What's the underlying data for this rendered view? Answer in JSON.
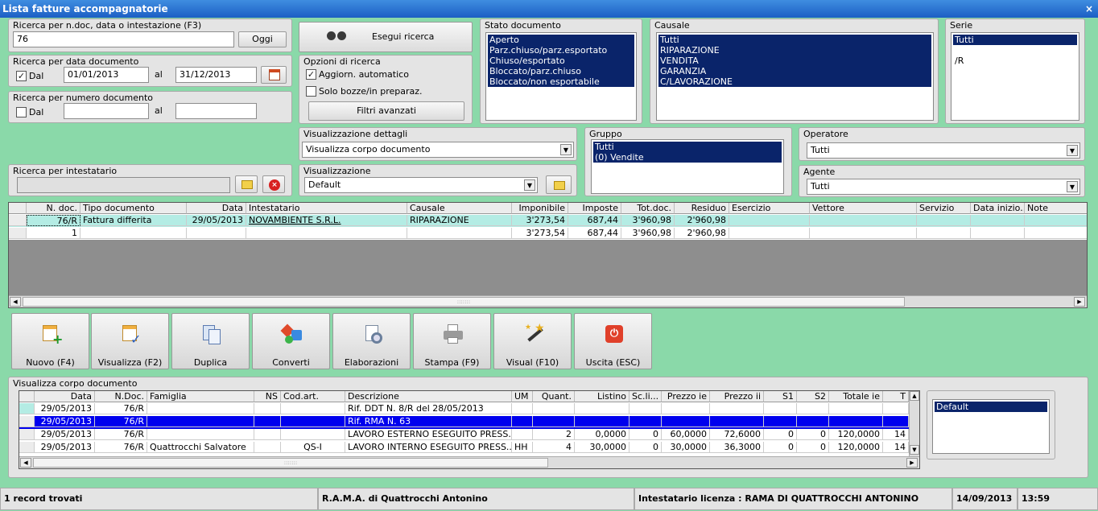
{
  "window": {
    "title": "Lista fatture accompagnatorie",
    "close": "×"
  },
  "search_ndoc": {
    "label": "Ricerca per n.doc, data o intestazione (F3)",
    "value": "76",
    "today_button": "Oggi"
  },
  "search_date": {
    "label": "Ricerca per data documento",
    "from_check": "✓",
    "from_label": "Dal",
    "from": "01/01/2013",
    "to_label": "al",
    "to": "31/12/2013"
  },
  "search_number": {
    "label": "Ricerca per numero documento",
    "from_label": "Dal",
    "to_label": "al"
  },
  "search_holder": {
    "label": "Ricerca per intestatario"
  },
  "execute_button": "Esegui ricerca",
  "options": {
    "label": "Opzioni di ricerca",
    "auto_update": "Aggiorn. automatico",
    "auto_check": "✓",
    "drafts_only": "Solo bozze/in preparaz.",
    "advanced_filters": "Filtri avanzati"
  },
  "stato": {
    "label": "Stato documento",
    "items": [
      "Aperto",
      "Parz.chiuso/parz.esportato",
      "Chiuso/esportato",
      "Bloccato/parz.chiuso",
      "Bloccato/non esportabile"
    ]
  },
  "causale": {
    "label": "Causale",
    "items": [
      "Tutti",
      "RIPARAZIONE",
      "VENDITA",
      "GARANZIA",
      "C/LAVORAZIONE"
    ]
  },
  "serie": {
    "label": "Serie",
    "items": [
      "Tutti",
      "",
      "/R"
    ]
  },
  "vis_dettagli": {
    "label": "Visualizzazione dettagli",
    "value": "Visualizza corpo documento"
  },
  "visualizzazione": {
    "label": "Visualizzazione",
    "value": "Default"
  },
  "gruppo": {
    "label": "Gruppo",
    "items": [
      "Tutti",
      "(0) Vendite"
    ]
  },
  "operatore": {
    "label": "Operatore",
    "value": "Tutti"
  },
  "agente": {
    "label": "Agente",
    "value": "Tutti"
  },
  "main_grid": {
    "headers": [
      "N. doc.",
      "Tipo documento",
      "Data",
      "Intestatario",
      "Causale",
      "Imponibile",
      "Imposte",
      "Tot.doc.",
      "Residuo",
      "Esercizio",
      "Vettore",
      "Servizio",
      "Data inizio...",
      "Note"
    ],
    "rows": [
      [
        "76/R",
        "Fattura differita",
        "29/05/2013",
        "NOVAMBIENTE S.R.L.",
        "RIPARAZIONE",
        "3'273,54",
        "687,44",
        "3'960,98",
        "2'960,98",
        "",
        "",
        "",
        "",
        ""
      ],
      [
        "1",
        "",
        "",
        "",
        "",
        "3'273,54",
        "687,44",
        "3'960,98",
        "2'960,98",
        "",
        "",
        "",
        "",
        ""
      ]
    ]
  },
  "actions": [
    "Nuovo (F4)",
    "Visualizza (F2)",
    "Duplica",
    "Converti",
    "Elaborazioni",
    "Stampa (F9)",
    "Visual (F10)",
    "Uscita (ESC)"
  ],
  "body_section": {
    "label": "Visualizza corpo documento"
  },
  "body_grid": {
    "headers": [
      "Data",
      "N.Doc.",
      "Famiglia",
      "NS",
      "Cod.art.",
      "Descrizione",
      "UM",
      "Quant.",
      "Listino",
      "Sc.li...",
      "Prezzo ie",
      "Prezzo ii",
      "S1",
      "S2",
      "Totale ie",
      "T"
    ],
    "rows": [
      [
        "29/05/2013",
        "76/R",
        "",
        "",
        "",
        "Rif. DDT N. 8/R del 28/05/2013",
        "",
        "",
        "",
        "",
        "",
        "",
        "",
        "",
        "",
        ""
      ],
      [
        "29/05/2013",
        "76/R",
        "",
        "",
        "",
        "Rif. RMA N. 63",
        "",
        "",
        "",
        "",
        "",
        "",
        "",
        "",
        "",
        ""
      ],
      [
        "29/05/2013",
        "76/R",
        "",
        "",
        "",
        "LAVORO ESTERNO ESEGUITO PRESS...",
        "",
        "2",
        "0,0000",
        "0",
        "60,0000",
        "72,6000",
        "0",
        "0",
        "120,0000",
        "14"
      ],
      [
        "29/05/2013",
        "76/R",
        "Quattrocchi Salvatore",
        "",
        "QS-I",
        "LAVORO INTERNO ESEGUITO PRESS...",
        "HH",
        "4",
        "30,0000",
        "0",
        "30,0000",
        "36,3000",
        "0",
        "0",
        "120,0000",
        "14"
      ]
    ]
  },
  "layouts": {
    "items": [
      "Default"
    ]
  },
  "status": {
    "records": "1 record trovati",
    "company": "R.A.M.A. di Quattrocchi Antonino",
    "license": "Intestatario licenza : RAMA DI QUATTROCCHI ANTONINO",
    "date": "14/09/2013",
    "time": "13:59"
  }
}
